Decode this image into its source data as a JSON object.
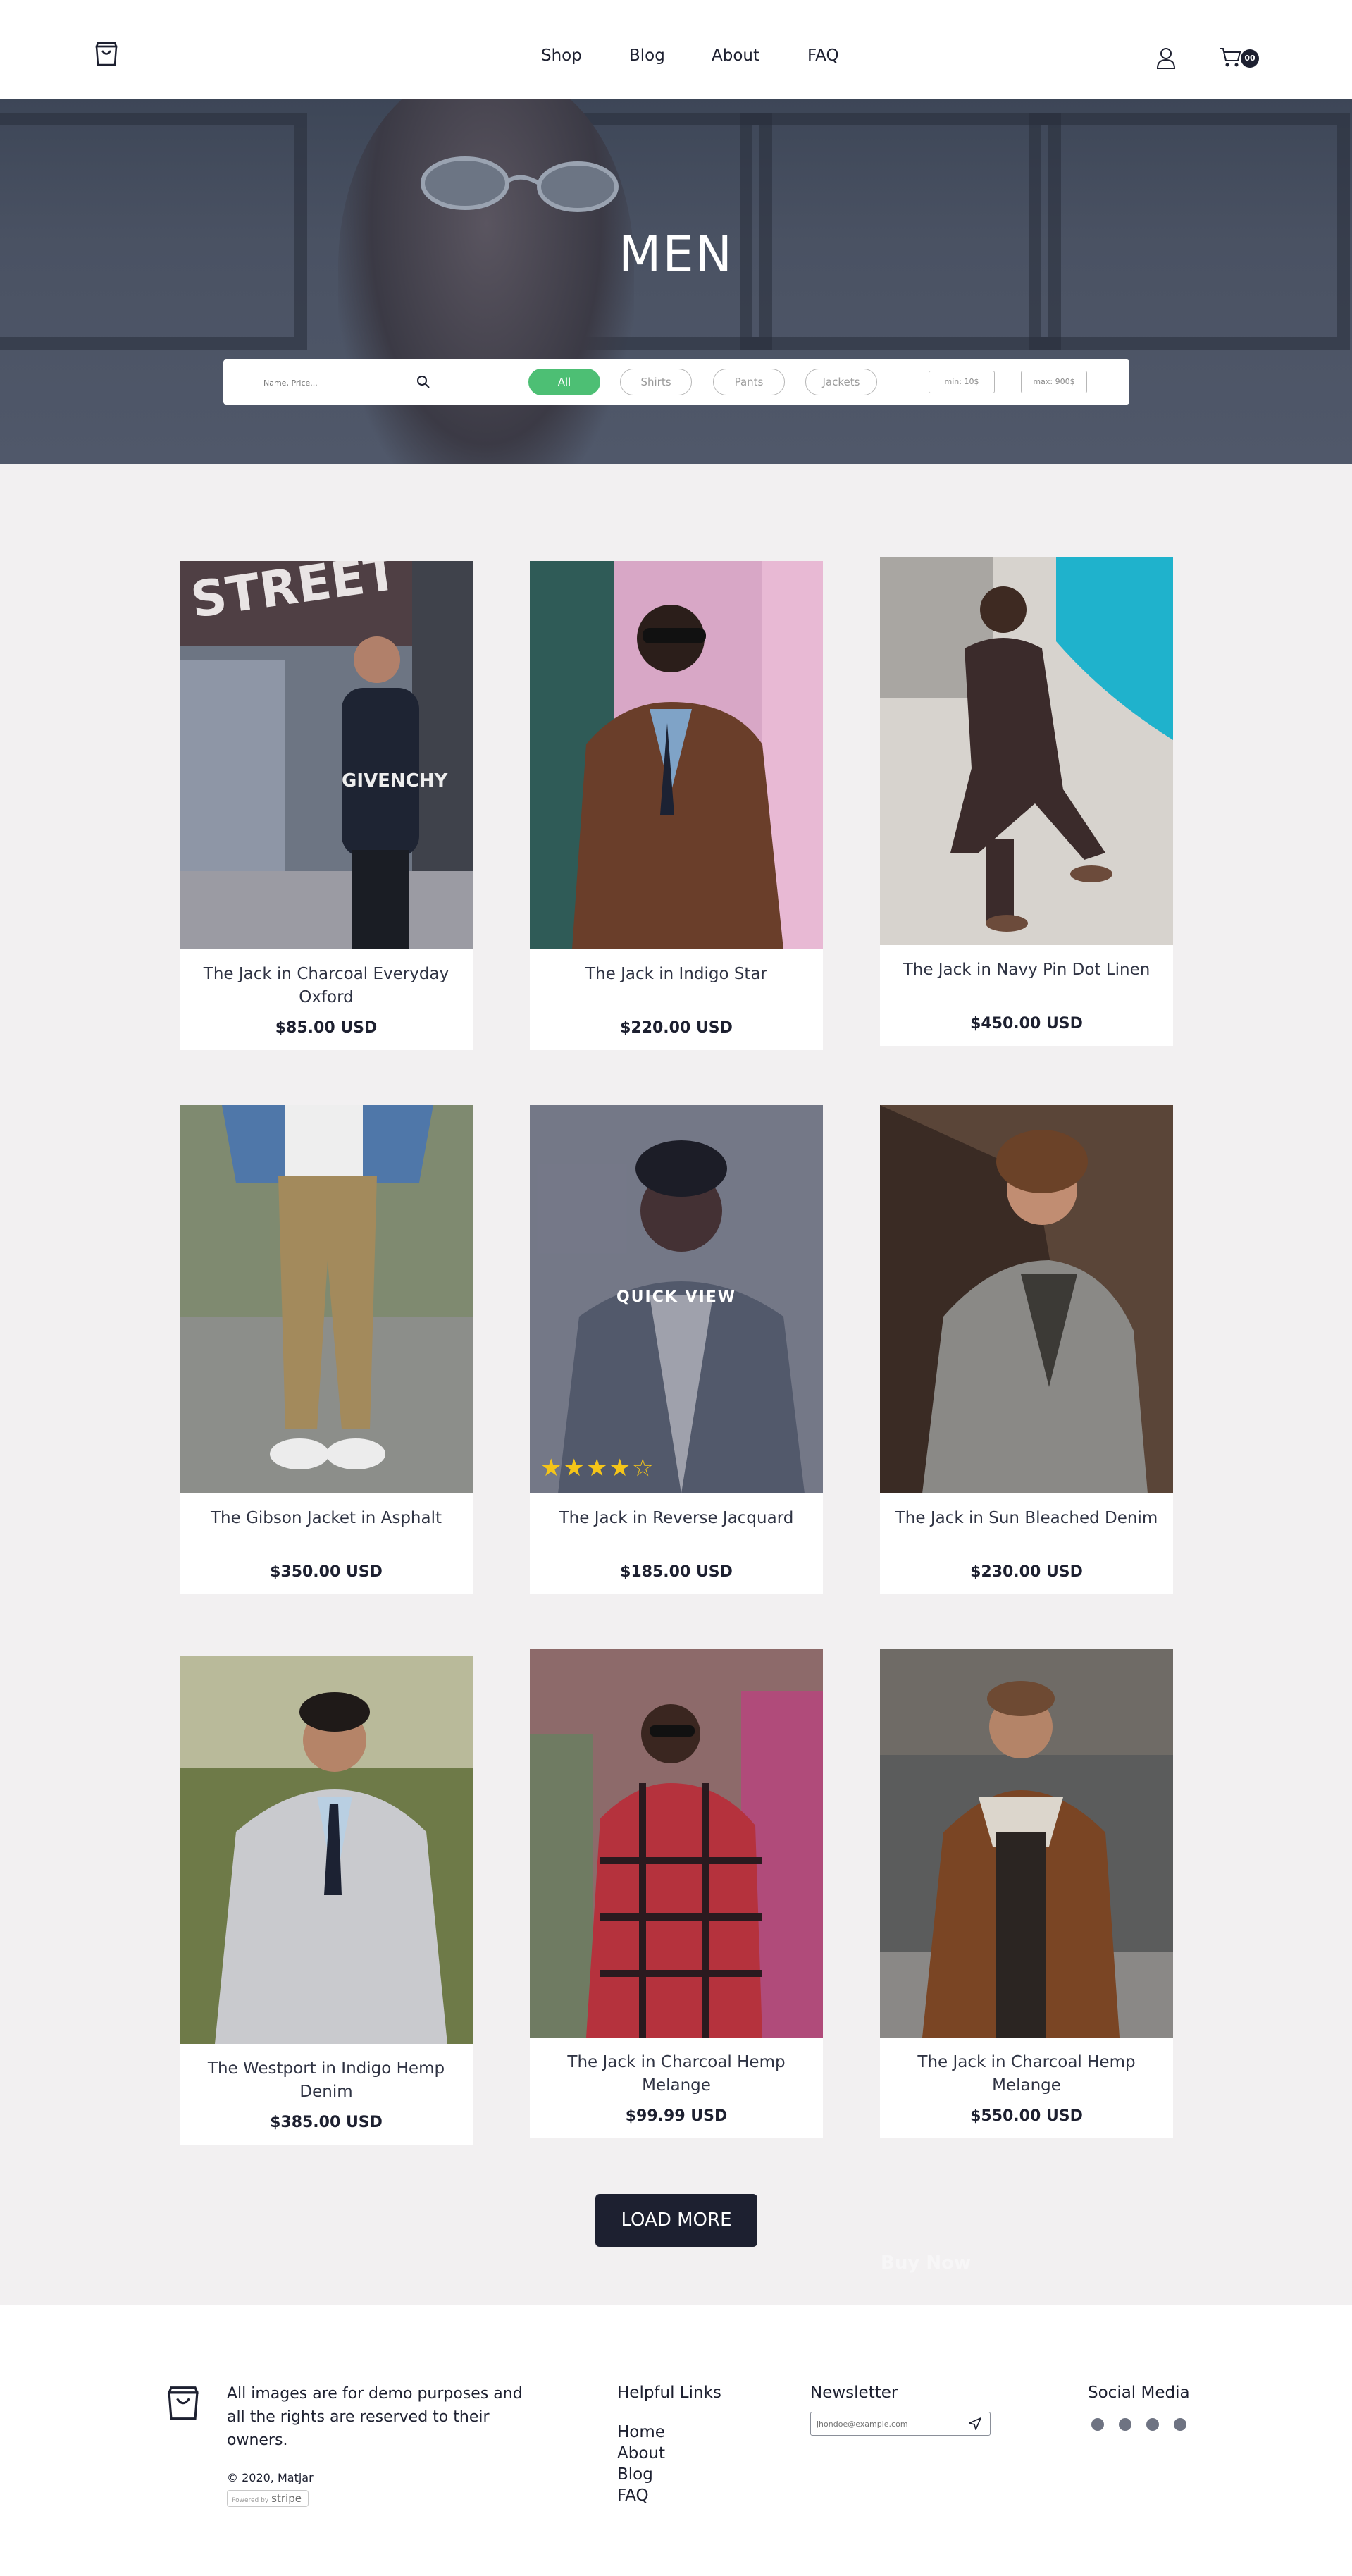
{
  "header": {
    "nav": [
      "Shop",
      "Blog",
      "About",
      "FAQ"
    ],
    "cart_count": "00",
    "icons": {
      "logo": "shopping-bag-logo-icon",
      "account": "user-icon",
      "cart": "cart-icon"
    }
  },
  "hero": {
    "title": "MEN",
    "search_placeholder": "Name, Price...",
    "filters": [
      "All",
      "Shirts",
      "Pants",
      "Jackets"
    ],
    "active_filter": "All",
    "min_placeholder": "min: 10$",
    "max_placeholder": "max: 900$"
  },
  "products": [
    {
      "name": "The Jack in Charcoal Everyday Oxford",
      "price": "$85.00 USD"
    },
    {
      "name": "The Jack in Indigo Star",
      "price": "$220.00 USD"
    },
    {
      "name": "The Jack in Navy Pin Dot Linen",
      "price": "$450.00 USD"
    },
    {
      "name": "The Gibson Jacket in Asphalt",
      "price": "$350.00 USD"
    },
    {
      "name": "The Jack in Reverse Jacquard",
      "price": "$185.00 USD",
      "quick_view": "QUICK VIEW",
      "rating": 4,
      "rating_max": 5
    },
    {
      "name": "The Jack in Sun Bleached Denim",
      "price": "$230.00 USD"
    },
    {
      "name": "The Westport in Indigo Hemp Denim",
      "price": "$385.00 USD"
    },
    {
      "name": "The Jack in Charcoal Hemp Melange",
      "price": "$99.99 USD"
    },
    {
      "name": "The Jack in Charcoal Hemp Melange",
      "price": "$550.00 USD"
    }
  ],
  "load_more": "LOAD MORE",
  "buy_now": "Buy Now",
  "footer": {
    "description": "All images are for demo purposes and all the rights are reserved to their owners.",
    "copyright": "© 2020, Matjar",
    "powered_by": "Powered by",
    "stripe": "stripe",
    "helpful_links_title": "Helpful Links",
    "helpful_links": [
      "Home",
      "About",
      "Blog",
      "FAQ"
    ],
    "newsletter_title": "Newsletter",
    "newsletter_placeholder": "jhondoe@example.com",
    "social_title": "Social Media",
    "social_icons": [
      "instagram-icon",
      "facebook-icon",
      "pinterest-icon",
      "twitter-icon"
    ]
  },
  "colors": {
    "accent": "#4dbf74",
    "dark": "#1d2030",
    "stars": "#f5c518"
  }
}
